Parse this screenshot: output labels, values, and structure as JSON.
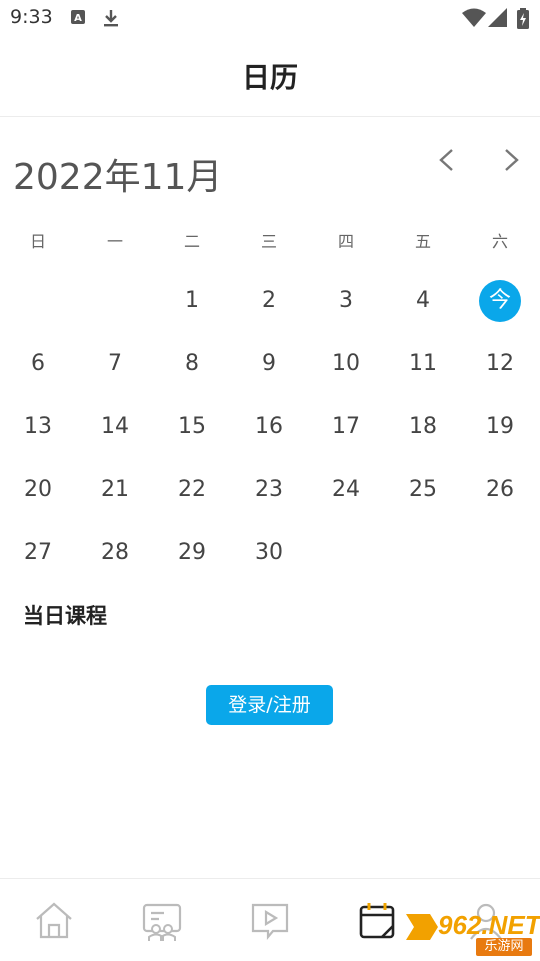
{
  "status_bar": {
    "time": "9:33",
    "icons": [
      "a-badge-icon",
      "download-icon",
      "wifi-icon",
      "signal-icon",
      "battery-icon"
    ]
  },
  "header": {
    "title": "日历"
  },
  "calendar": {
    "month_title": "2022年11月",
    "prev_icon": "chevron-left-icon",
    "next_icon": "chevron-right-icon",
    "weekdays": [
      "日",
      "一",
      "二",
      "三",
      "四",
      "五",
      "六"
    ],
    "today_label": "今",
    "today_color": "#0aa7ea",
    "weeks": [
      [
        "",
        "",
        "1",
        "2",
        "3",
        "4",
        "今"
      ],
      [
        "6",
        "7",
        "8",
        "9",
        "10",
        "11",
        "12"
      ],
      [
        "13",
        "14",
        "15",
        "16",
        "17",
        "18",
        "19"
      ],
      [
        "20",
        "21",
        "22",
        "23",
        "24",
        "25",
        "26"
      ],
      [
        "27",
        "28",
        "29",
        "30",
        "",
        "",
        ""
      ]
    ]
  },
  "courses": {
    "title": "当日课程",
    "login_button": "登录/注册"
  },
  "bottom_nav": {
    "items": [
      "home-icon",
      "class-icon",
      "video-icon",
      "calendar-icon",
      "profile-icon"
    ],
    "active": "calendar-icon"
  },
  "watermark": {
    "brand": "962.NET",
    "sub": "乐游网"
  }
}
